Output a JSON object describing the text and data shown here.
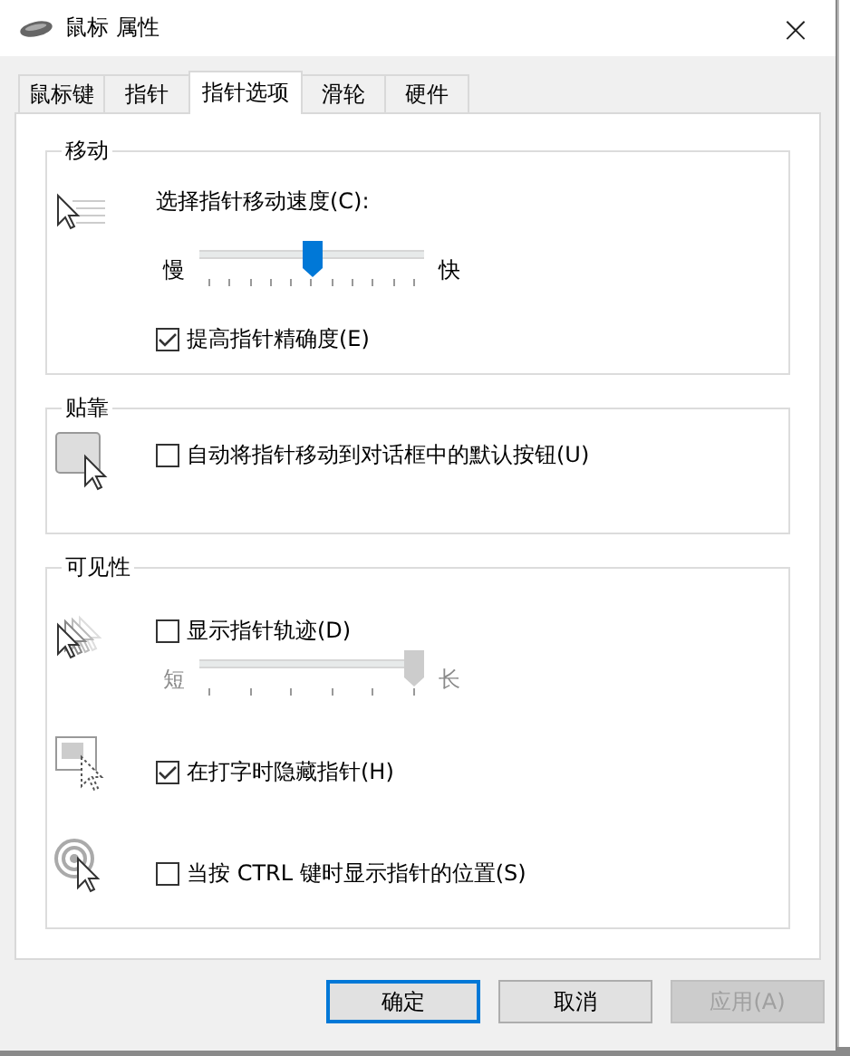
{
  "window": {
    "title": "鼠标 属性",
    "close": "×"
  },
  "tabs": [
    {
      "label": "鼠标键",
      "selected": false
    },
    {
      "label": "指针",
      "selected": false
    },
    {
      "label": "指针选项",
      "selected": true
    },
    {
      "label": "滑轮",
      "selected": false
    },
    {
      "label": "硬件",
      "selected": false
    }
  ],
  "groups": [
    {
      "title": "移动",
      "sections": [
        {
          "rows": [
            {
              "kind": "label",
              "text": "选择指针移动速度(C):"
            },
            {
              "kind": "slider",
              "low": "慢",
              "high": "快",
              "level": 0.5,
              "disabled": false
            },
            {
              "kind": "checkbox",
              "label": "提高指针精确度(E)",
              "checked": true
            }
          ]
        }
      ]
    },
    {
      "title": "贴靠",
      "sections": [
        {
          "rows": [
            {
              "kind": "checkbox",
              "label": "自动将指针移动到对话框中的默认按钮(U)",
              "checked": false
            }
          ]
        }
      ]
    },
    {
      "title": "可见性",
      "sections": [
        {
          "rows": [
            {
              "kind": "checkbox",
              "label": "显示指针轨迹(D)",
              "checked": false
            },
            {
              "kind": "slider",
              "low": "短",
              "high": "长",
              "level": 1,
              "disabled": true
            }
          ]
        },
        {
          "rows": [
            {
              "kind": "checkbox",
              "label": "在打字时隐藏指针(H)",
              "checked": true
            }
          ]
        },
        {
          "rows": [
            {
              "kind": "checkbox",
              "label": "当按 CTRL 键时显示指针的位置(S)",
              "checked": false
            }
          ]
        }
      ]
    }
  ],
  "buttons": [
    {
      "label": "确定",
      "default": true,
      "disabled": false
    },
    {
      "label": "取消",
      "default": false,
      "disabled": false
    },
    {
      "label": "应用(A)",
      "default": false,
      "disabled": true
    }
  ]
}
